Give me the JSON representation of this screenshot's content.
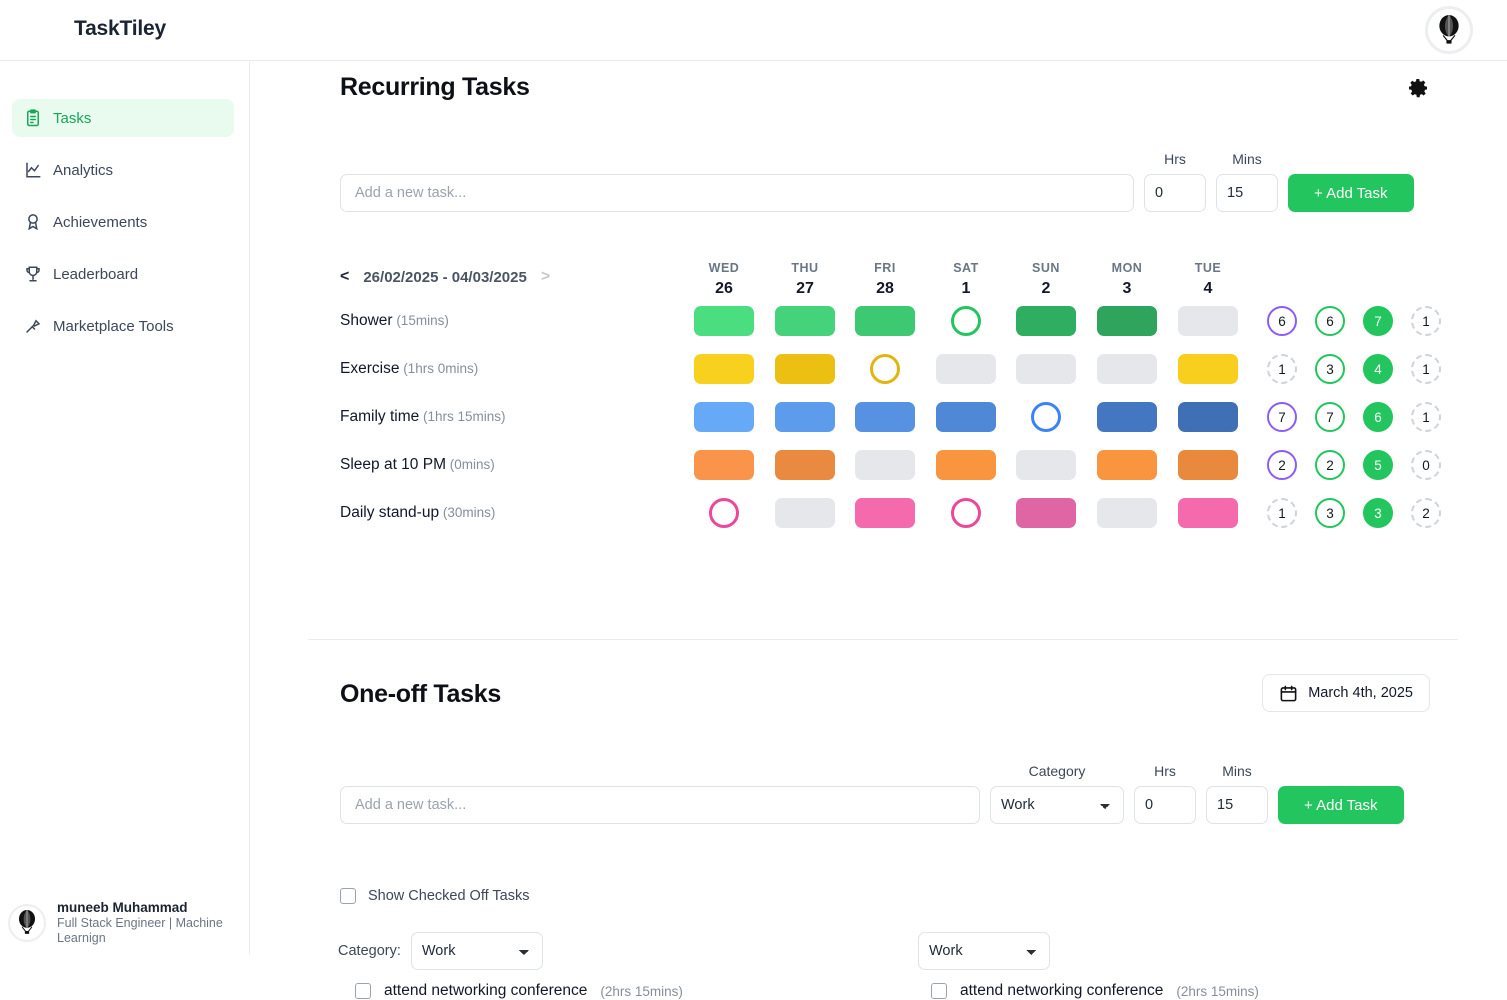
{
  "app": {
    "brand": "TaskTiley",
    "avatar_icon": "hot-air-balloon-icon"
  },
  "sidebar": {
    "items": [
      {
        "label": "Tasks",
        "icon": "clipboard-list-icon",
        "active": true
      },
      {
        "label": "Analytics",
        "icon": "line-chart-icon",
        "active": false
      },
      {
        "label": "Achievements",
        "icon": "award-medal-icon",
        "active": false
      },
      {
        "label": "Leaderboard",
        "icon": "trophy-icon",
        "active": false
      },
      {
        "label": "Marketplace Tools",
        "icon": "wrench-tool-icon",
        "active": false
      }
    ],
    "profile": {
      "name": "muneeb Muhammad",
      "role": "Full Stack Engineer | Machine Learnign",
      "avatar_icon": "hot-air-balloon-icon"
    }
  },
  "recurring": {
    "title": "Recurring Tasks",
    "settings_icon": "gear-icon",
    "add_form": {
      "task_placeholder": "Add a new task...",
      "task_value": "",
      "hrs_label": "Hrs",
      "hrs_value": "0",
      "mins_label": "Mins",
      "mins_value": "15",
      "add_label": "+ Add Task"
    },
    "week": {
      "prev_icon": "chevron-left-icon",
      "next_icon": "chevron-right-icon",
      "range": "26/02/2025 - 04/03/2025",
      "days": [
        {
          "dow": "WED",
          "dom": "26"
        },
        {
          "dow": "THU",
          "dom": "27"
        },
        {
          "dow": "FRI",
          "dom": "28"
        },
        {
          "dow": "SAT",
          "dom": "1"
        },
        {
          "dow": "SUN",
          "dom": "2"
        },
        {
          "dow": "MON",
          "dom": "3"
        },
        {
          "dow": "TUE",
          "dom": "4"
        }
      ]
    },
    "rows": [
      {
        "name": "Shower",
        "duration": "(15mins)",
        "base_color": "#4ade80",
        "cells": [
          "tile",
          "tile",
          "tile",
          "ring",
          "tile",
          "tile",
          "empty"
        ],
        "shades": [
          "#4ade80",
          "#44d27a",
          "#3dc972",
          "#22c55e",
          "#2fae62",
          "#2ea45c",
          ""
        ],
        "ring_color": "#22c55e",
        "badges": [
          {
            "value": "6",
            "style": "purple"
          },
          {
            "value": "6",
            "style": "greenline"
          },
          {
            "value": "7",
            "style": "greenfill"
          },
          {
            "value": "1",
            "style": "dashed"
          }
        ]
      },
      {
        "name": "Exercise",
        "duration": "(1hrs 0mins)",
        "base_color": "#facc15",
        "cells": [
          "tile",
          "tile",
          "ring",
          "empty",
          "empty",
          "empty",
          "tile"
        ],
        "shades": [
          "#f8d11e",
          "#ecc013",
          "",
          "",
          "",
          "",
          "#f8cf1d"
        ],
        "ring_color": "#e3b411",
        "badges": [
          {
            "value": "1",
            "style": "dashed"
          },
          {
            "value": "3",
            "style": "greenline"
          },
          {
            "value": "4",
            "style": "greenfill"
          },
          {
            "value": "1",
            "style": "dashed"
          }
        ]
      },
      {
        "name": "Family time",
        "duration": "(1hrs 15mins)",
        "base_color": "#60a5fa",
        "cells": [
          "tile",
          "tile",
          "tile",
          "tile",
          "ring",
          "tile",
          "tile"
        ],
        "shades": [
          "#66a9f7",
          "#5d9ced",
          "#5691e2",
          "#4f88d6",
          "#3b82f6",
          "#4477c2",
          "#3f6fb4"
        ],
        "ring_color": "#3b82f6",
        "badges": [
          {
            "value": "7",
            "style": "purple"
          },
          {
            "value": "7",
            "style": "greenline"
          },
          {
            "value": "6",
            "style": "greenfill"
          },
          {
            "value": "1",
            "style": "dashed"
          }
        ]
      },
      {
        "name": "Sleep at 10 PM",
        "duration": "(0mins)",
        "base_color": "#f9944a",
        "cells": [
          "tile",
          "tile",
          "empty",
          "tile",
          "empty",
          "tile",
          "tile"
        ],
        "shades": [
          "#f9944a",
          "#ea8a40",
          "",
          "#f9943f",
          "",
          "#f9943f",
          "#e8893e"
        ],
        "ring_color": "#f97316",
        "badges": [
          {
            "value": "2",
            "style": "purple"
          },
          {
            "value": "2",
            "style": "greenline"
          },
          {
            "value": "5",
            "style": "greenfill"
          },
          {
            "value": "0",
            "style": "dashed"
          }
        ]
      },
      {
        "name": "Daily stand-up",
        "duration": "(30mins)",
        "base_color": "#f472b6",
        "cells": [
          "ring",
          "empty",
          "tile",
          "ring",
          "tile",
          "empty",
          "tile"
        ],
        "shades": [
          "",
          "",
          "#f569ad",
          "",
          "#e065a5",
          "",
          "#f569ad"
        ],
        "ring_color": "#ec4899",
        "badges": [
          {
            "value": "1",
            "style": "dashed"
          },
          {
            "value": "3",
            "style": "greenline"
          },
          {
            "value": "3",
            "style": "greenfill"
          },
          {
            "value": "2",
            "style": "dashed"
          }
        ]
      }
    ],
    "empty_tile_color": "#e5e7eb"
  },
  "oneoff": {
    "title": "One-off Tasks",
    "date_button": {
      "label": "March 4th, 2025",
      "icon": "calendar-icon"
    },
    "add_form": {
      "task_placeholder": "Add a new task...",
      "task_value": "",
      "category_label": "Category",
      "category_value": "Work",
      "hrs_label": "Hrs",
      "hrs_value": "0",
      "mins_label": "Mins",
      "mins_value": "15",
      "add_label": "+ Add Task"
    },
    "show_checked_label": "Show Checked Off Tasks",
    "show_checked_value": false,
    "columns": [
      {
        "category_prefix": "Category:",
        "category_value": "Work",
        "tasks": [
          {
            "name": "attend networking conference",
            "duration": "(2hrs 15mins)",
            "checked": false
          }
        ]
      },
      {
        "category_prefix": "",
        "category_value": "Work",
        "tasks": [
          {
            "name": "attend networking conference",
            "duration": "(2hrs 15mins)",
            "checked": false
          }
        ]
      }
    ]
  },
  "colors": {
    "accent_green": "#22c55e",
    "active_nav_bg": "#e9faef",
    "purple": "#8b5cf6"
  }
}
